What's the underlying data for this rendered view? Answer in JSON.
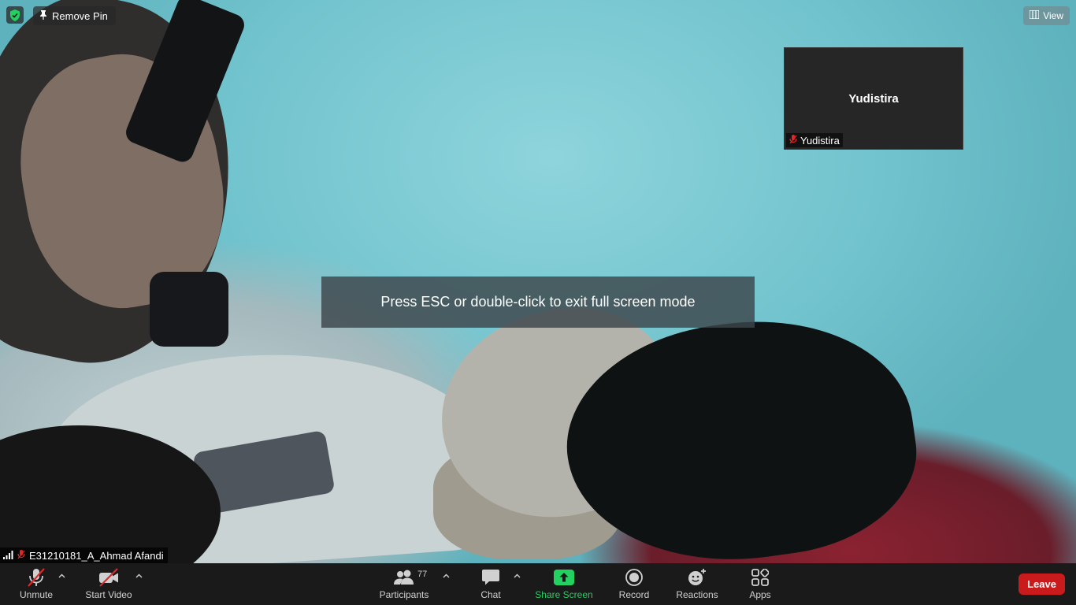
{
  "topbar": {
    "remove_pin_label": "Remove Pin",
    "view_label": "View"
  },
  "thumbnail": {
    "participant_name": "Yudistira",
    "name_tag": "Yudistira"
  },
  "toast": {
    "message": "Press ESC or double-click to exit full screen mode"
  },
  "self_view": {
    "name_tag": "E31210181_A_Ahmad Afandi"
  },
  "toolbar": {
    "unmute_label": "Unmute",
    "start_video_label": "Start Video",
    "participants_label": "Participants",
    "participants_count": "77",
    "chat_label": "Chat",
    "share_screen_label": "Share Screen",
    "record_label": "Record",
    "reactions_label": "Reactions",
    "apps_label": "Apps",
    "leave_label": "Leave"
  },
  "colors": {
    "accent_green": "#23d160",
    "leave_red": "#c91b1b",
    "toolbar_bg": "#1a1a1a",
    "muted_red": "#e02828"
  }
}
